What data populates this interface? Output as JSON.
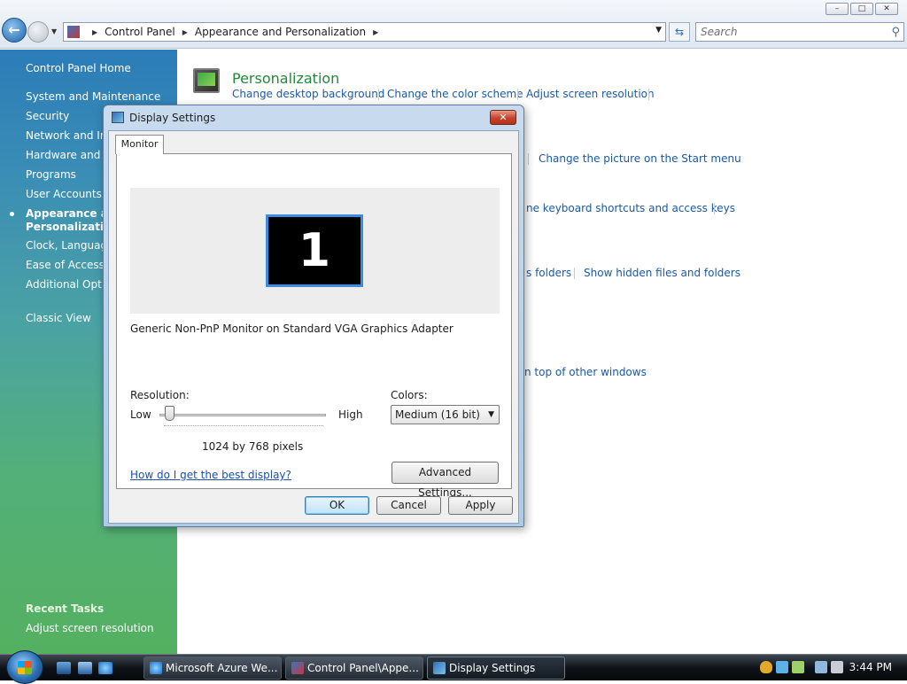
{
  "window": {
    "controls": {
      "minimize": "–",
      "maximize": "□",
      "close": "✕"
    }
  },
  "address_bar": {
    "crumbs": [
      "Control Panel",
      "Appearance and Personalization"
    ]
  },
  "search": {
    "placeholder": "Search"
  },
  "left_pane": {
    "items": [
      "Control Panel Home",
      "System and Maintenance",
      "Security",
      "Network and Int",
      "Hardware and So",
      "Programs",
      "User Accounts",
      "Appearance and",
      "Personalization",
      "Clock, Language",
      "Ease of Access",
      "Additional Optio",
      "Classic View"
    ],
    "recent_tasks_title": "Recent Tasks",
    "recent_tasks": [
      "Adjust screen resolution"
    ]
  },
  "main": {
    "personalization_title": "Personalization",
    "links": {
      "desktop_bg": "Change desktop background",
      "color_scheme": "Change the color scheme",
      "screen_res": "Adjust screen resolution",
      "start_picture": "Change the picture on the Start menu",
      "keyboard_shortcuts": "ne keyboard shortcuts and access keys",
      "folders": "s folders",
      "hidden_files": "Show hidden files and folders",
      "top_windows": "n top of other windows"
    }
  },
  "dialog": {
    "title": "Display Settings",
    "tab": "Monitor",
    "monitor_number": "1",
    "monitor_name": "Generic Non-PnP Monitor on Standard VGA Graphics Adapter",
    "resolution_label": "Resolution:",
    "low": "Low",
    "high": "High",
    "resolution_value": "1024 by 768 pixels",
    "resolution_slider_fraction": 0.0,
    "colors_label": "Colors:",
    "colors_value": "Medium (16 bit)",
    "help_link": "How do I get the best display?",
    "advanced_button": "Advanced Settings...",
    "ok": "OK",
    "cancel": "Cancel",
    "apply": "Apply"
  },
  "taskbar": {
    "buttons": [
      {
        "label": "Microsoft Azure We...",
        "icon": "ie-icon"
      },
      {
        "label": "Control Panel\\Appe...",
        "icon": "control-panel-icon"
      },
      {
        "label": "Display Settings",
        "icon": "display-settings-icon",
        "active": true
      }
    ],
    "clock": "3:44 PM"
  },
  "colors": {
    "link": "#1959a8",
    "title_green": "#218a38",
    "accent_blue": "#3a8ee0"
  }
}
